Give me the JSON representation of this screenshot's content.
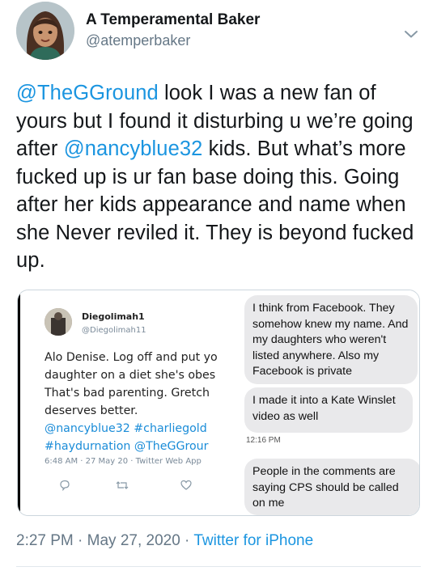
{
  "author": {
    "name": "A Temperamental Baker",
    "handle": "@atemperbaker"
  },
  "tweet": {
    "mention1": "@TheGGround",
    "text1": " look I was a new fan of yours but I found it disturbing u we’re going after ",
    "mention2": "@nancyblue32",
    "text2": " kids. But what’s more fucked up is ur fan base doing this. Going after her kids appearance and name when she Never reviled it. They is beyond fucked up."
  },
  "embedded": {
    "name": "Diegolimah1",
    "handle": "@Diegolimah11",
    "lines": [
      "Alo Denise. Log off and put yo",
      "daughter on a diet she's obes",
      "That's bad parenting. Gretch",
      "deserves better."
    ],
    "tag_line1": "@nancyblue32 #charliegold",
    "tag_line2": "#haydurnation @TheGGrour",
    "meta": "6:48 AM · 27 May 20 · Twitter Web App"
  },
  "messages": {
    "m1": "I think from Facebook. They somehow knew my name. And my daughters who weren't listed anywhere. Also my Facebook is private",
    "m2": "I made it into a Kate Winslet video as well",
    "time": "12:16 PM",
    "m3": "People in the comments are saying CPS should be called on me"
  },
  "footer": {
    "time": "2:27 PM · May 27, 2020 · ",
    "source": "Twitter for iPhone"
  },
  "colors": {
    "link": "#1b95e0",
    "secondary": "#657786",
    "bubble": "#e9e9eb"
  }
}
